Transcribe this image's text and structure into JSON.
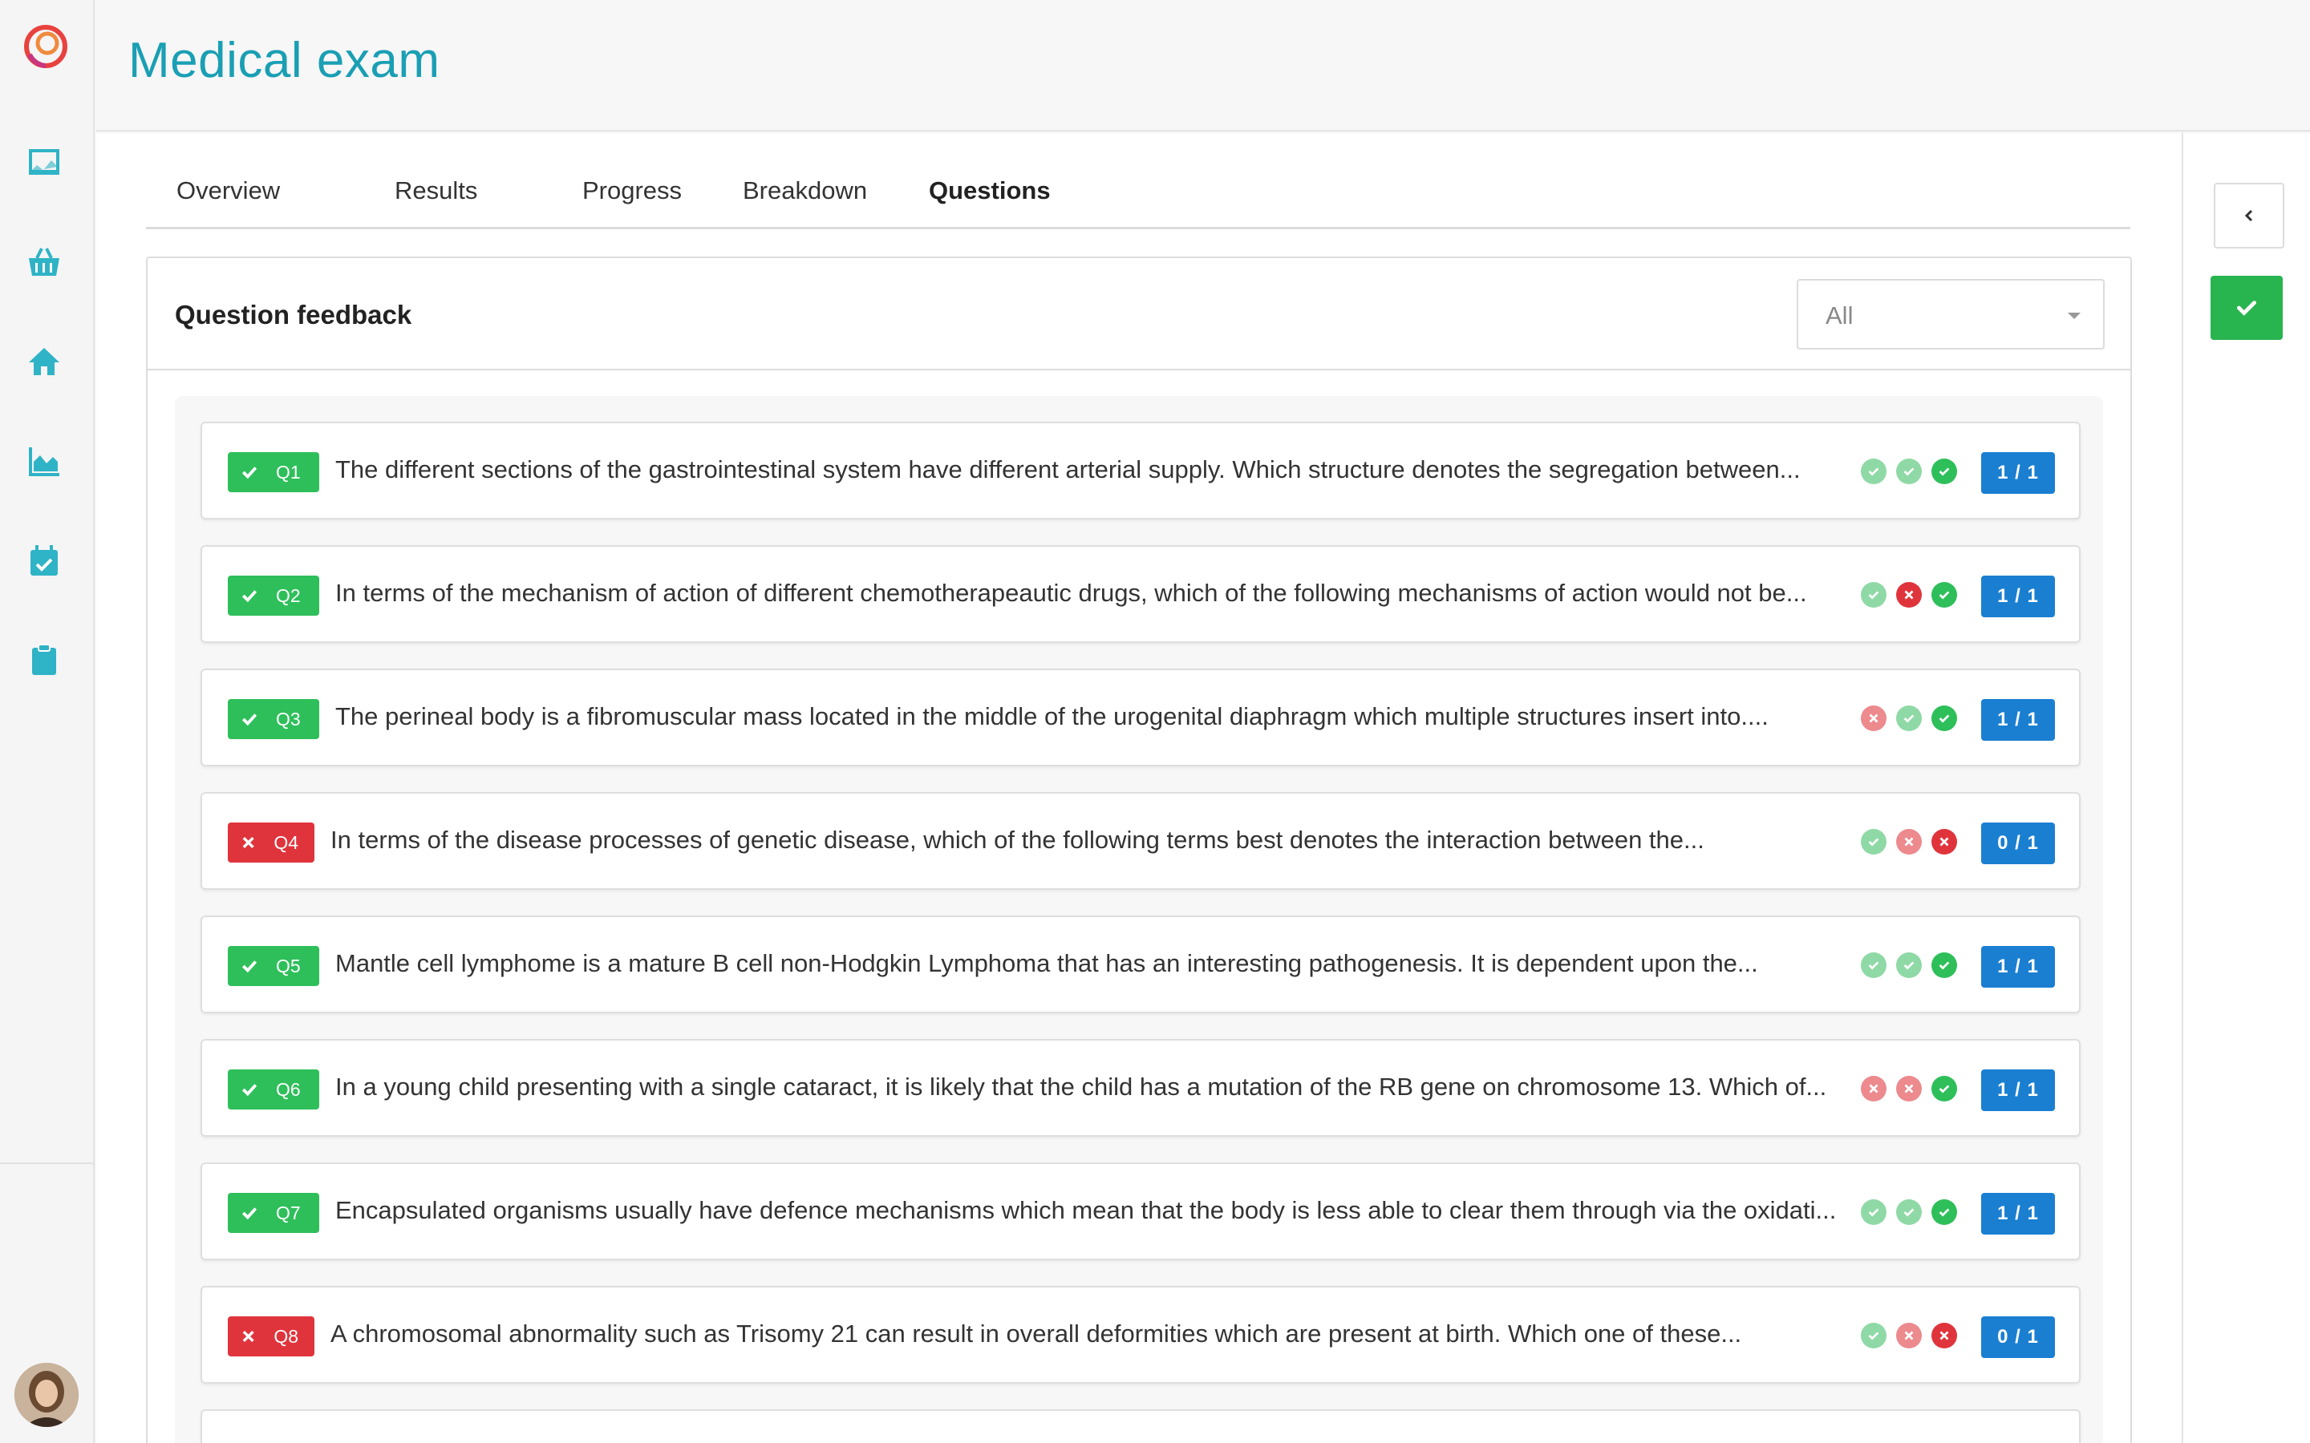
{
  "header": {
    "title": "Medical exam"
  },
  "tabs": [
    {
      "label": "Overview",
      "active": false
    },
    {
      "label": "Results",
      "active": false
    },
    {
      "label": "Progress",
      "active": false
    },
    {
      "label": "Breakdown",
      "active": false
    },
    {
      "label": "Questions",
      "active": true
    }
  ],
  "panel": {
    "title": "Question feedback",
    "filter": {
      "value": "All"
    }
  },
  "questions": [
    {
      "id": "Q1",
      "correct": true,
      "text": "The different sections of the gastrointestinal system have different arterial supply. Which structure denotes the segregation between...",
      "history": [
        "ok-light",
        "ok-light",
        "ok"
      ],
      "score": "1 / 1"
    },
    {
      "id": "Q2",
      "correct": true,
      "text": "In terms of the mechanism of action of different chemotherapeautic drugs, which of the following mechanisms of action would not be...",
      "history": [
        "ok-light",
        "bad",
        "ok"
      ],
      "score": "1 / 1"
    },
    {
      "id": "Q3",
      "correct": true,
      "text": "The perineal body is a fibromuscular mass located in the middle of the urogenital diaphragm which multiple structures insert into....",
      "history": [
        "bad-light",
        "ok-light",
        "ok"
      ],
      "score": "1 / 1"
    },
    {
      "id": "Q4",
      "correct": false,
      "text": "In terms of the disease processes of genetic disease, which of the following terms best denotes the interaction between the...",
      "history": [
        "ok-light",
        "bad-light",
        "bad"
      ],
      "score": "0 / 1"
    },
    {
      "id": "Q5",
      "correct": true,
      "text": "Mantle cell lymphome is a mature B cell non-Hodgkin Lymphoma that has an interesting pathogenesis. It is dependent upon the...",
      "history": [
        "ok-light",
        "ok-light",
        "ok"
      ],
      "score": "1 / 1"
    },
    {
      "id": "Q6",
      "correct": true,
      "text": "In a young child presenting with a single cataract, it is likely that the child has a mutation of the RB gene on chromosome 13. Which of...",
      "history": [
        "bad-light",
        "bad-light",
        "ok"
      ],
      "score": "1 / 1"
    },
    {
      "id": "Q7",
      "correct": true,
      "text": "Encapsulated organisms usually have defence mechanisms which mean that the body is less able to clear them through via the oxidati...",
      "history": [
        "ok-light",
        "ok-light",
        "ok"
      ],
      "score": "1 / 1"
    },
    {
      "id": "Q8",
      "correct": false,
      "text": "A chromosomal abnormality such as Trisomy 21 can result in overall deformities which are present at birth. Which one of these...",
      "history": [
        "ok-light",
        "bad-light",
        "bad"
      ],
      "score": "0 / 1"
    }
  ],
  "icons": {
    "logo": "logo-icon",
    "nav": [
      "presentation-icon",
      "basket-icon",
      "home-icon",
      "area-chart-icon",
      "calendar-check-icon",
      "clipboard-icon"
    ],
    "collapse": "chevron-left-icon",
    "confirm": "check-icon"
  },
  "colors": {
    "accent": "#1a9fb4",
    "correct": "#2ebf5a",
    "incorrect": "#e0343c",
    "score": "#1a7fd1"
  }
}
